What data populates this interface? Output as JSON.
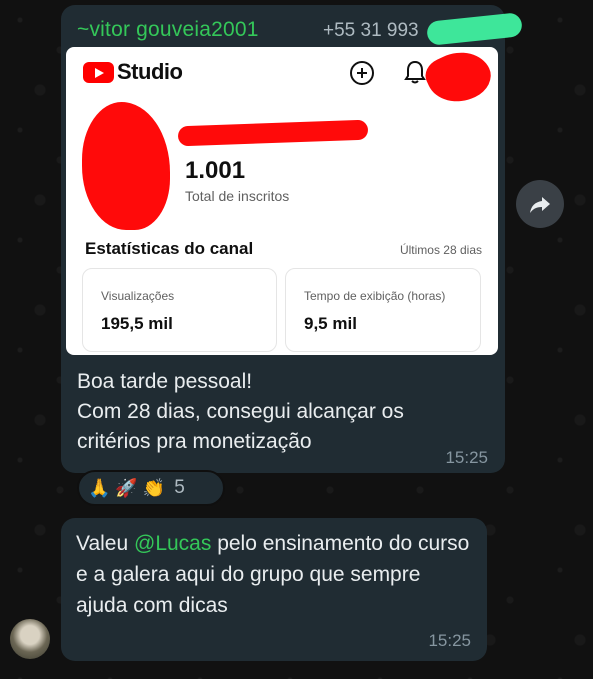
{
  "chat": {
    "message1": {
      "sender_name": "~vitor gouveia2001",
      "sender_phone": "+55 31 993",
      "image": {
        "app_name": "Studio",
        "subscribers_count": "1.001",
        "subscribers_label": "Total de inscritos",
        "stats_title": "Estatísticas do canal",
        "stats_period": "Últimos 28 dias",
        "stats": [
          {
            "label": "Visualizações",
            "value": "195,5 mil"
          },
          {
            "label": "Tempo de exibição (horas)",
            "value": "9,5 mil"
          }
        ],
        "icons": [
          "youtube-logo-icon",
          "create-icon",
          "bell-icon"
        ]
      },
      "text_line1": "Boa tarde pessoal!",
      "text_line2": "Com 28 dias, consegui alcançar os",
      "text_line3": "critérios pra monetização",
      "time": "15:25",
      "reactions": {
        "emojis": [
          "🙏",
          "🚀",
          "👏"
        ],
        "count": "5"
      }
    },
    "message2": {
      "text_before": "Valeu ",
      "mention": "@Lucas",
      "text_after": " pelo ensinamento do curso e a galera aqui do grupo que sempre ajuda com dicas",
      "time": "15:25"
    }
  },
  "colors": {
    "bubble": "#202c33",
    "accent_green": "#34c759",
    "youtube_red": "#ff0000",
    "redaction_red": "#ff0a0a",
    "redaction_green": "#3ee69a"
  }
}
